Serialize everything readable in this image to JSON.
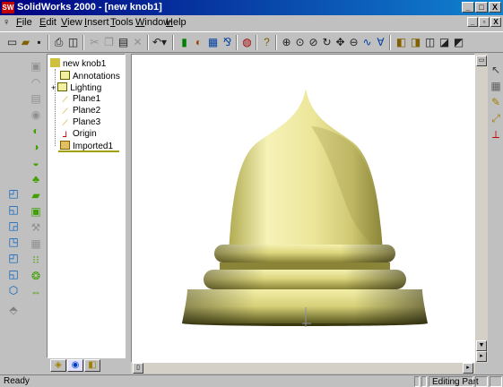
{
  "window": {
    "title": "SolidWorks 2000 - [new knob1]",
    "logo_text": "SW",
    "caption_buttons": [
      "_",
      "□",
      "X"
    ],
    "mdi_buttons": [
      "_",
      "▫",
      "X"
    ]
  },
  "menu": {
    "items": [
      "File",
      "Edit",
      "View",
      "Insert",
      "Tools",
      "Window",
      "Help"
    ]
  },
  "toolbar": {
    "icons": [
      "new-icon",
      "open-icon",
      "save-icon",
      "print-icon",
      "print-preview-icon",
      "cut-icon",
      "copy-icon",
      "paste-icon",
      "delete-icon",
      "undo-icon",
      "rebuild-icon",
      "options-icon",
      "color-icon",
      "select-icon",
      "edit-color-icon",
      "help-icon",
      "zoom-fit-icon",
      "zoom-in-icon",
      "zoom-area-icon",
      "rotate-icon",
      "pan-icon",
      "zoom-icon",
      "wireframe-icon",
      "hidden-lines-icon",
      "shaded-icon",
      "perspective-icon",
      "section-icon",
      "view-orientation-icon"
    ]
  },
  "tree": {
    "items": [
      {
        "label": "new knob1",
        "icon": "part-icon"
      },
      {
        "label": "Annotations",
        "icon": "annotations-icon"
      },
      {
        "label": "Lighting",
        "icon": "lighting-icon"
      },
      {
        "label": "Plane1",
        "icon": "plane-icon"
      },
      {
        "label": "Plane2",
        "icon": "plane-icon"
      },
      {
        "label": "Plane3",
        "icon": "plane-icon"
      },
      {
        "label": "Origin",
        "icon": "origin-icon"
      },
      {
        "label": "Imported1",
        "icon": "imported-feature-icon"
      }
    ],
    "expander": "+"
  },
  "status": {
    "left": "Ready",
    "right": "Editing Part"
  },
  "colors": {
    "model_light": "#f4f0b0",
    "model_mid": "#d8d27a",
    "model_dark": "#7a7a30",
    "titlebar": "#000080",
    "chrome": "#c0c0c0"
  }
}
